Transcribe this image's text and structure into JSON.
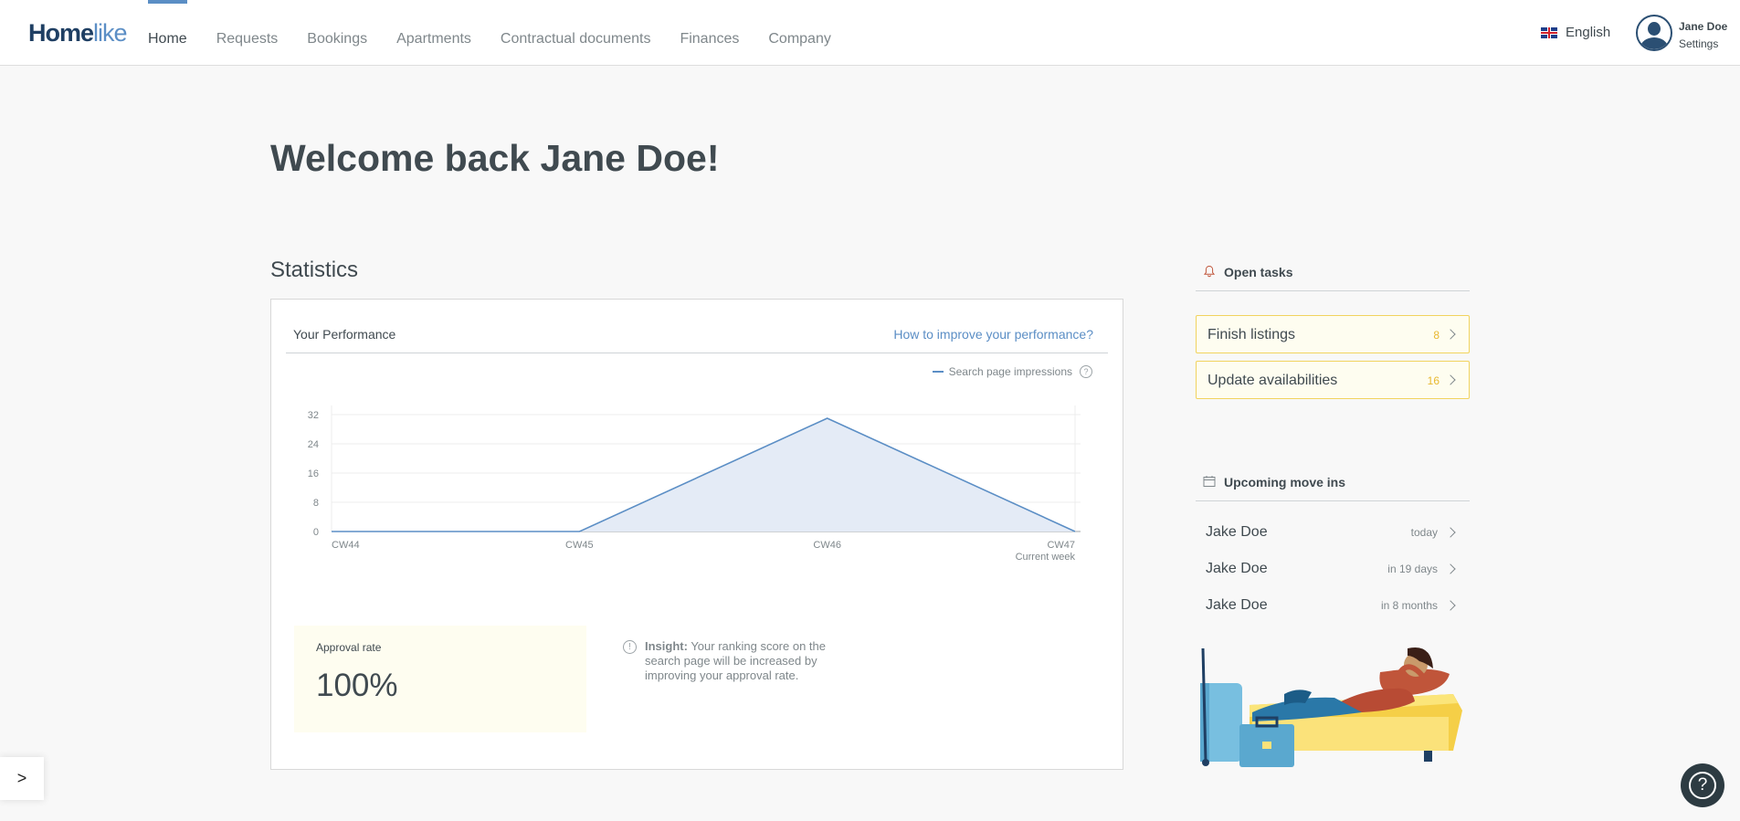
{
  "brand": {
    "logo_bold": "Home",
    "logo_thin": "like"
  },
  "nav": {
    "items": [
      {
        "label": "Home",
        "active": true
      },
      {
        "label": "Requests"
      },
      {
        "label": "Bookings"
      },
      {
        "label": "Apartments"
      },
      {
        "label": "Contractual documents"
      },
      {
        "label": "Finances"
      },
      {
        "label": "Company"
      }
    ]
  },
  "header": {
    "language": "English",
    "language_icon": "uk-flag-icon",
    "user_name": "Jane Doe",
    "settings_label": "Settings"
  },
  "welcome": {
    "prefix": "Welcome back",
    "name": "Jane Doe!"
  },
  "statistics": {
    "title": "Statistics",
    "card_title": "Your Performance",
    "improve_link": "How to improve your performance?",
    "legend_label": "Search page impressions",
    "approval_label": "Approval rate",
    "approval_value": "100%",
    "insight_label": "Insight:",
    "insight_text": "Your ranking score on the search page will be increased by improving your approval rate."
  },
  "chart_data": {
    "type": "area",
    "categories": [
      "CW44",
      "CW45",
      "CW46",
      "CW47"
    ],
    "x_sublabels": [
      "",
      "",
      "",
      "Current week"
    ],
    "series": [
      {
        "name": "Search page impressions",
        "values": [
          0,
          0,
          31,
          0
        ],
        "color": "#5b8ec5"
      }
    ],
    "yticks": [
      0,
      8,
      16,
      24,
      32
    ],
    "ylim": [
      0,
      32
    ],
    "grid": true,
    "legend_position": "top-right"
  },
  "open_tasks": {
    "title": "Open tasks",
    "icon": "bell-icon",
    "items": [
      {
        "label": "Finish listings",
        "count": "8"
      },
      {
        "label": "Update availabilities",
        "count": "16"
      }
    ]
  },
  "move_ins": {
    "title": "Upcoming move ins",
    "icon": "calendar-icon",
    "items": [
      {
        "name": "Jake Doe",
        "when": "today"
      },
      {
        "name": "Jake Doe",
        "when": "in 19 days"
      },
      {
        "name": "Jake Doe",
        "when": "in 8 months"
      }
    ]
  },
  "floating": {
    "toggle_label": ">",
    "help_label": "?"
  },
  "colors": {
    "accent": "#5b8ec5",
    "task_border": "#f1d35f",
    "task_count": "#e8b830",
    "text": "#404a50"
  }
}
